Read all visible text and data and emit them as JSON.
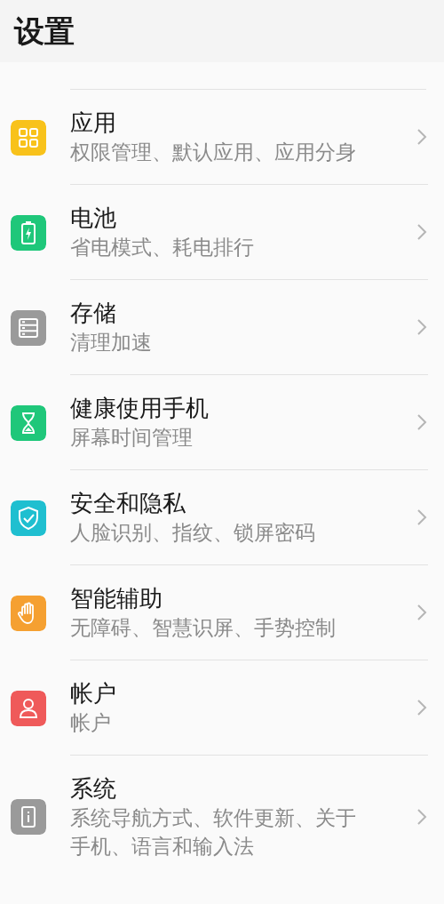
{
  "header": {
    "title": "设置"
  },
  "items": [
    {
      "title": "应用",
      "subtitle": "权限管理、默认应用、应用分身",
      "color": "#f8c21b"
    },
    {
      "title": "电池",
      "subtitle": "省电模式、耗电排行",
      "color": "#1fc77a"
    },
    {
      "title": "存储",
      "subtitle": "清理加速",
      "color": "#9a9a9a"
    },
    {
      "title": "健康使用手机",
      "subtitle": "屏幕时间管理",
      "color": "#1fc77a"
    },
    {
      "title": "安全和隐私",
      "subtitle": "人脸识别、指纹、锁屏密码",
      "color": "#1fbfd0"
    },
    {
      "title": "智能辅助",
      "subtitle": "无障碍、智慧识屏、手势控制",
      "color": "#f5a031"
    },
    {
      "title": "帐户",
      "subtitle": "帐户",
      "color": "#ef5a5a"
    },
    {
      "title": "系统",
      "subtitle": "系统导航方式、软件更新、关于手机、语言和输入法",
      "color": "#9a9a9a"
    }
  ]
}
